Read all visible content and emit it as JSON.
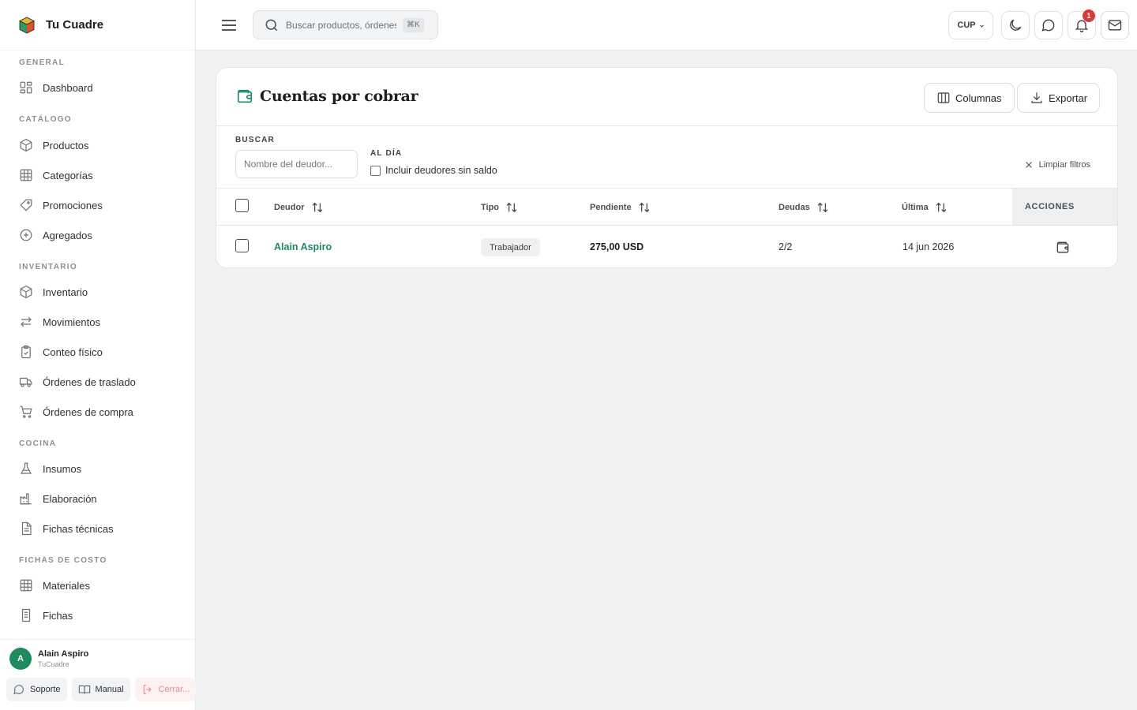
{
  "app": {
    "brand": "Tu Cuadre"
  },
  "sidebar": {
    "sections": [
      {
        "label": "GENERAL",
        "items": [
          {
            "label": "Dashboard",
            "icon": "dashboard-icon"
          }
        ]
      },
      {
        "label": "CATÁLOGO",
        "items": [
          {
            "label": "Productos",
            "icon": "box-icon"
          },
          {
            "label": "Categorías",
            "icon": "grid-icon"
          },
          {
            "label": "Promociones",
            "icon": "tag-icon"
          },
          {
            "label": "Agregados",
            "icon": "plus-circle-icon"
          }
        ]
      },
      {
        "label": "INVENTARIO",
        "items": [
          {
            "label": "Inventario",
            "icon": "box-icon"
          },
          {
            "label": "Movimientos",
            "icon": "arrows-icon"
          },
          {
            "label": "Conteo físico",
            "icon": "clipboard-check-icon"
          },
          {
            "label": "Órdenes de traslado",
            "icon": "truck-icon"
          },
          {
            "label": "Órdenes de compra",
            "icon": "cart-icon"
          }
        ]
      },
      {
        "label": "COCINA",
        "items": [
          {
            "label": "Insumos",
            "icon": "flask-icon"
          },
          {
            "label": "Elaboración",
            "icon": "factory-icon"
          },
          {
            "label": "Fichas técnicas",
            "icon": "document-icon"
          }
        ]
      },
      {
        "label": "FICHAS DE COSTO",
        "items": [
          {
            "label": "Materiales",
            "icon": "grid-icon"
          },
          {
            "label": "Fichas",
            "icon": "document-icon"
          }
        ]
      }
    ],
    "user": {
      "initial": "A",
      "name": "Alain Aspiro",
      "org": "TuCuadre"
    },
    "footer": {
      "support": "Soporte",
      "manual": "Manual",
      "logout": "Cerrar..."
    }
  },
  "topbar": {
    "search_placeholder": "Buscar productos, órdenes...",
    "search_shortcut": "⌘K",
    "currency": "CUP",
    "notifications_count": "1"
  },
  "page": {
    "title": "Cuentas por cobrar",
    "columns_button": "Columnas",
    "export_button": "Exportar",
    "filters": {
      "search_label": "BUSCAR",
      "search_placeholder": "Nombre del deudor...",
      "status_label": "AL DÍA",
      "include_label": "Incluir deudores sin saldo",
      "clear_label": "Limpiar filtros"
    },
    "table": {
      "headers": {
        "debtor": "Deudor",
        "type": "Tipo",
        "pending": "Pendiente",
        "debts": "Deudas",
        "last": "Última",
        "actions": "ACCIONES"
      },
      "rows": [
        {
          "debtor": "Alain Aspiro",
          "type": "Trabajador",
          "pending": "275,00 USD",
          "debts": "2/2",
          "last": "14 jun 2026"
        }
      ]
    }
  },
  "colors": {
    "accent": "#1f8a5f",
    "badge": "#d93a35",
    "logout": "#e58b8b"
  }
}
